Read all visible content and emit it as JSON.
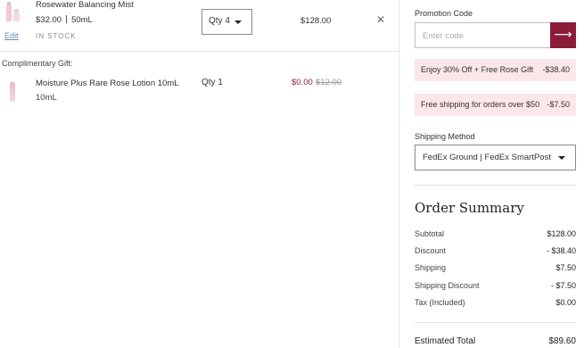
{
  "cart": {
    "item": {
      "name": "Rosewater Balancing Mist",
      "price": "$32.00",
      "size": "50mL",
      "edit_label": "Edit",
      "stock_status": "IN STOCK",
      "qty_label": "Qty 4",
      "line_total": "$128.00",
      "remove_icon": "close-icon"
    },
    "gift": {
      "heading": "Complimentary Gift:",
      "name": "Moisture Plus Rare Rose Lotion 10mL",
      "size": "10mL",
      "qty_label": "Qty 1",
      "price": "$0.00",
      "original_price": "$12.00"
    }
  },
  "promo": {
    "label": "Promotion Code",
    "placeholder": "Enter code",
    "apply_icon": "arrow-right-icon",
    "applied": [
      {
        "label": "Enjoy 30% Off + Free Rose Gift",
        "amount": "-$38.40"
      },
      {
        "label": "Free shipping for orders over $50",
        "amount": "-$7.50"
      }
    ]
  },
  "shipping": {
    "label": "Shipping Method",
    "selected": "FedEx Ground | FedEx SmartPost"
  },
  "summary": {
    "title": "Order Summary",
    "rows": [
      {
        "label": "Subtotal",
        "value": "$128.00"
      },
      {
        "label": "Discount",
        "value": "- $38.40"
      },
      {
        "label": "Shipping",
        "value": "$7.50"
      },
      {
        "label": "Shipping Discount",
        "value": "- $7.50"
      },
      {
        "label": "Tax (Included)",
        "value": "$0.00"
      }
    ],
    "estimated_label": "Estimated Total",
    "estimated_value": "$89.60"
  },
  "colors": {
    "accent": "#8b1d3b",
    "promo_bg": "#fbe6e9"
  }
}
